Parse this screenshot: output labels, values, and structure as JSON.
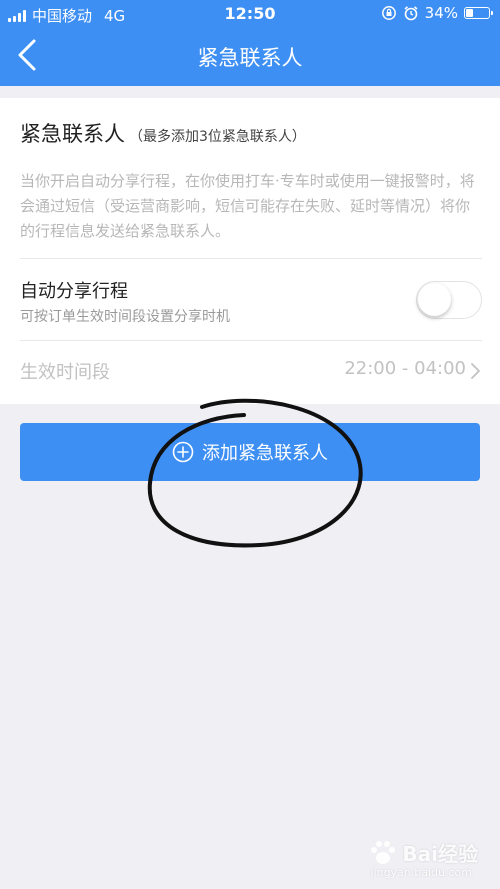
{
  "status_bar": {
    "carrier": "中国移动",
    "network": "4G",
    "time": "12:50",
    "battery": "34%",
    "battery_level": 0.34
  },
  "nav": {
    "title": "紧急联系人",
    "back_icon": "chevron-left-icon"
  },
  "card": {
    "title": "紧急联系人",
    "subtitle": "（最多添加3位紧急联系人）",
    "description": "当你开启自动分享行程，在你使用打车·专车时或使用一键报警时，将会通过短信（受运营商影响，短信可能存在失败、延时等情况）将你的行程信息发送给紧急联系人。",
    "auto_share": {
      "title": "自动分享行程",
      "hint": "可按订单生效时间段设置分享时机",
      "enabled": false
    },
    "time_range": {
      "label": "生效时间段",
      "value": "22:00 - 04:00"
    }
  },
  "add_button": {
    "label": "添加紧急联系人",
    "icon": "plus-circle-icon"
  },
  "watermark": {
    "text": "Bai经验",
    "sub": "jingyan.baidu.com"
  },
  "colors": {
    "primary": "#3d8ff3",
    "background": "#efeff4",
    "annotation": "#111111"
  }
}
